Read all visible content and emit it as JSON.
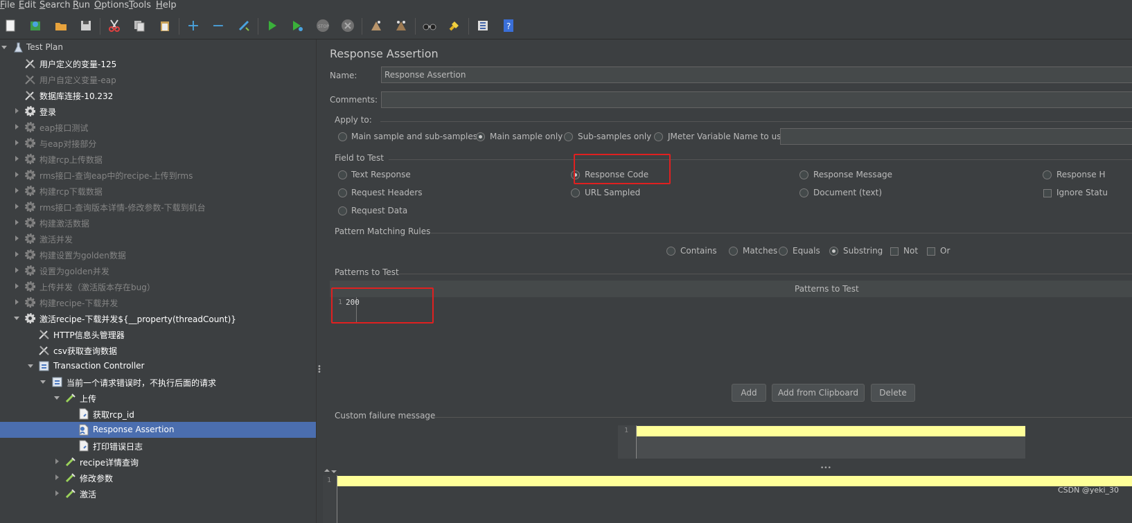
{
  "menubar": {
    "items": [
      {
        "label": "File",
        "u": "F",
        "rest": "ile"
      },
      {
        "label": "Edit",
        "u": "E",
        "rest": "dit"
      },
      {
        "label": "Search",
        "u": "S",
        "rest": "earch"
      },
      {
        "label": "Run",
        "u": "R",
        "rest": "un"
      },
      {
        "label": "Options",
        "u": "O",
        "rest": "ptions"
      },
      {
        "label": "Tools",
        "u": "T",
        "rest": "ools"
      },
      {
        "label": "Help",
        "u": "H",
        "rest": "elp"
      }
    ]
  },
  "toolbar": {
    "icons": [
      "new-icon",
      "templates-icon",
      "open-icon",
      "save-icon",
      "cut-icon",
      "copy-icon",
      "paste-icon",
      "expand-icon",
      "collapse-icon",
      "toggle-icon",
      "start-icon",
      "start-no-pause-icon",
      "stop-icon",
      "shutdown-icon",
      "clear-icon",
      "clear-all-icon",
      "search-icon",
      "reset-search-icon",
      "function-helper-icon",
      "help-icon"
    ]
  },
  "tree": {
    "items": [
      {
        "label": "Test Plan",
        "state": "normal"
      },
      {
        "label": "用户定义的变量-125",
        "state": "white"
      },
      {
        "label": "用户自定义变量-eap",
        "state": "dim"
      },
      {
        "label": "数据库连接-10.232",
        "state": "white"
      },
      {
        "label": "登录",
        "state": "white"
      },
      {
        "label": "eap接口测试",
        "state": "dim"
      },
      {
        "label": "与eap对接部分",
        "state": "dim"
      },
      {
        "label": "构建rcp上传数据",
        "state": "dim"
      },
      {
        "label": "rms接口-查询eap中的recipe-上传到rms",
        "state": "dim"
      },
      {
        "label": "构建rcp下载数据",
        "state": "dim"
      },
      {
        "label": "rms接口-查询版本详情-修改参数-下载到机台",
        "state": "dim"
      },
      {
        "label": "构建激活数据",
        "state": "dim"
      },
      {
        "label": "激活并发",
        "state": "dim"
      },
      {
        "label": "构建设置为golden数据",
        "state": "dim"
      },
      {
        "label": "设置为golden并发",
        "state": "dim"
      },
      {
        "label": "上传并发（激活版本存在bug）",
        "state": "dim"
      },
      {
        "label": "构建recipe-下载并发",
        "state": "dim"
      },
      {
        "label": "激活recipe-下载并发${__property(threadCount)}",
        "state": "white"
      },
      {
        "label": "HTTP信息头管理器",
        "state": "white"
      },
      {
        "label": "csv获取查询数据",
        "state": "white"
      },
      {
        "label": "Transaction Controller",
        "state": "white"
      },
      {
        "label": "当前一个请求错误时，不执行后面的请求",
        "state": "white"
      },
      {
        "label": "上传",
        "state": "white"
      },
      {
        "label": "获取rcp_id",
        "state": "white"
      },
      {
        "label": "Response Assertion",
        "state": "white"
      },
      {
        "label": "打印错误日志",
        "state": "white"
      },
      {
        "label": "recipe详情查询",
        "state": "white"
      },
      {
        "label": "修改参数",
        "state": "white"
      },
      {
        "label": "激活",
        "state": "white"
      }
    ]
  },
  "panel": {
    "title": "Response Assertion",
    "name_label": "Name:",
    "name_value": "Response Assertion",
    "comments_label": "Comments:",
    "comments_value": "",
    "apply_to": {
      "title": "Apply to:",
      "options": [
        "Main sample and sub-samples",
        "Main sample only",
        "Sub-samples only",
        "JMeter Variable Name to use"
      ],
      "selected": "Main sample only",
      "variable_value": ""
    },
    "field_to_test": {
      "title": "Field to Test",
      "options": [
        "Text Response",
        "Response Code",
        "Response Message",
        "Response H",
        "Request Headers",
        "URL Sampled",
        "Document (text)",
        "Ignore Statu",
        "Request Data"
      ],
      "selected": "Response Code"
    },
    "pattern_rules": {
      "title": "Pattern Matching Rules",
      "radios": [
        "Contains",
        "Matches",
        "Equals",
        "Substring"
      ],
      "selected": "Substring",
      "checks": [
        "Not",
        "Or"
      ]
    },
    "patterns": {
      "title": "Patterns to Test",
      "column_header": "Patterns to Test",
      "line_number": "1",
      "value": "200",
      "buttons": [
        "Add",
        "Add from Clipboard",
        "Delete"
      ]
    },
    "custom_failure": {
      "title": "Custom failure message",
      "line_number": "1",
      "value": ""
    },
    "bottom_editor": {
      "line_number": "1",
      "value": ""
    }
  },
  "watermark": "CSDN @yeki_30",
  "colors": {
    "background": "#3c3f41",
    "selection": "#4b6eaf",
    "highlight_box": "#e02020",
    "editor_yellow": "#ffff99"
  }
}
